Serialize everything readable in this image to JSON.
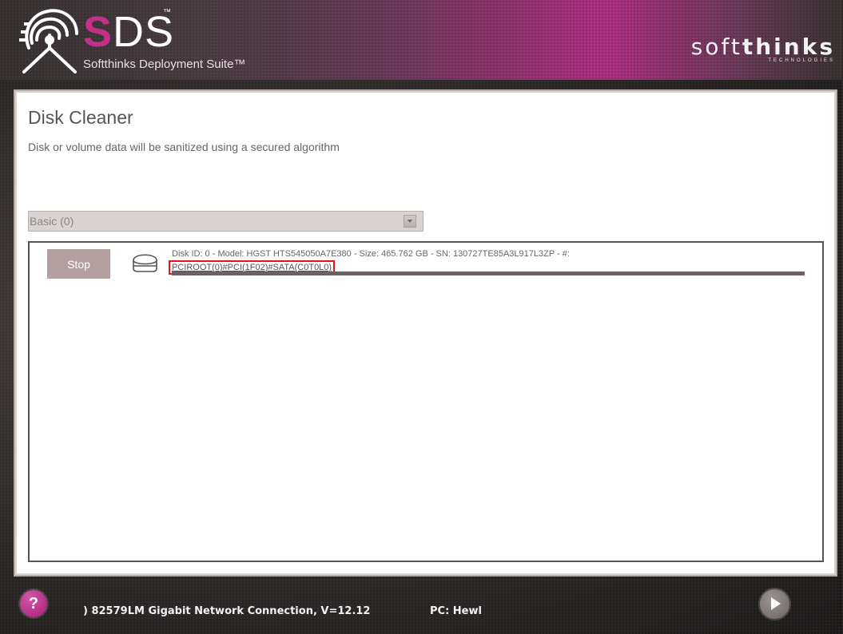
{
  "header": {
    "logo_text_first": "S",
    "logo_text_rest": "DS",
    "logo_tm": "™",
    "suite_name": "Softthinks Deployment Suite™",
    "brand_name_light": "soft",
    "brand_name_bold": "thinks",
    "brand_sub": "TECHNOLOGIES"
  },
  "page": {
    "title": "Disk Cleaner",
    "subtitle": "Disk or volume data will be sanitized using a secured algorithm"
  },
  "disk_selector": {
    "selected": "Basic (0)"
  },
  "disks": [
    {
      "action_label": "Stop",
      "info_line1": "Disk ID: 0 - Model: HGST HTS545050A7E380 - Size: 465.762 GB - SN: 130727TE85A3L917L3ZP - #:",
      "info_line2": "PCIROOT(0)#PCI(1F02)#SATA(C0T0L0)",
      "progress_percent": 100
    }
  ],
  "footer": {
    "help_label": "?",
    "network_text": ") 82579LM Gigabit Network Connection, V=12.12",
    "pc_text": "PC: Hewl"
  },
  "colors": {
    "accent": "#c43088",
    "stop_button": "#b59ea0",
    "highlight_border": "#e2141c"
  }
}
